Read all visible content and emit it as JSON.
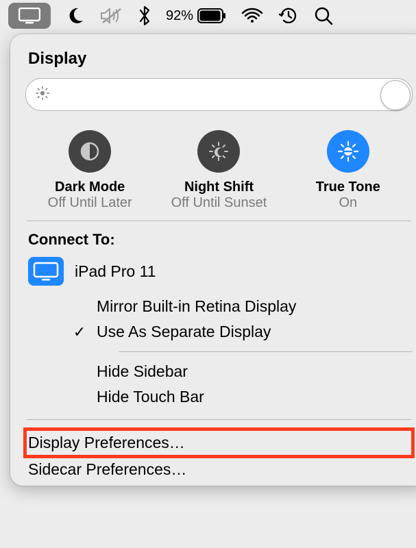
{
  "menubar": {
    "battery_pct": "92%"
  },
  "popup": {
    "title": "Display",
    "modes": {
      "dark": {
        "name": "Dark Mode",
        "sub": "Off Until Later"
      },
      "night": {
        "name": "Night Shift",
        "sub": "Off Until Sunset"
      },
      "true": {
        "name": "True Tone",
        "sub": "On"
      }
    },
    "connect_label": "Connect To:",
    "device_name": "iPad Pro 11",
    "opts": {
      "mirror": "Mirror Built-in Retina Display",
      "separate": "Use As Separate Display",
      "hidebar": "Hide Sidebar",
      "hidetb": "Hide Touch Bar"
    },
    "display_prefs": "Display Preferences…",
    "sidecar_prefs": "Sidecar Preferences…"
  }
}
